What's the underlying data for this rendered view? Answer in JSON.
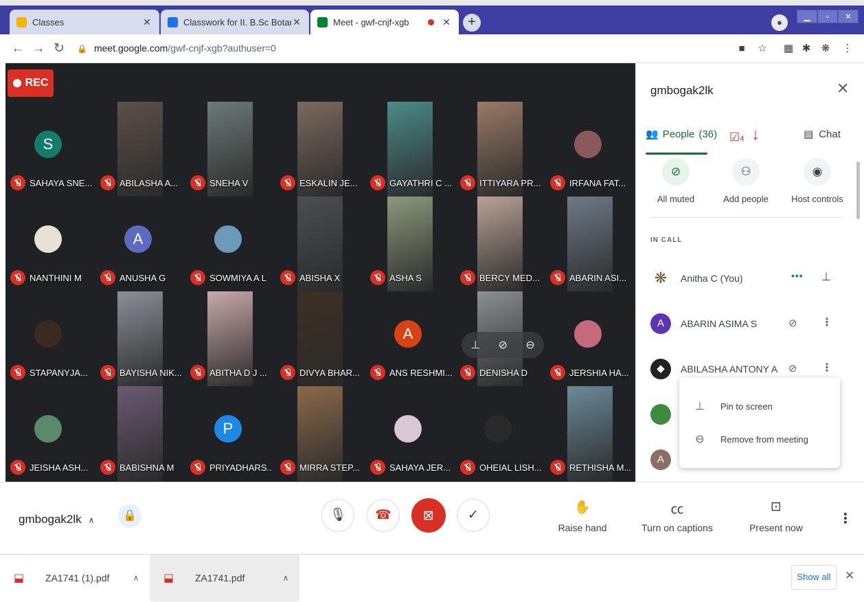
{
  "browser": {
    "tabs": [
      {
        "title": "Classes",
        "favicon_color": "#f4b400"
      },
      {
        "title": "Classwork for II. B.Sc Botany Allie",
        "favicon_color": "#1a73e8"
      },
      {
        "title": "Meet - gwf-cnjf-xgb",
        "favicon_color": "#00832d"
      }
    ],
    "url_host": "meet.google.com",
    "url_path": "/gwf-cnjf-xgb?authuser=0"
  },
  "stage": {
    "rec_label": "REC",
    "tiles": [
      {
        "name": "SAHAYA SNE...",
        "avatar": "S",
        "color": "#137c6b"
      },
      {
        "name": "ABILASHA A...",
        "photo": "#5b5147"
      },
      {
        "name": "SNEHA V",
        "photo": "#6b7b77"
      },
      {
        "name": "ESKALIN JE...",
        "photo": "#7a6a5e"
      },
      {
        "name": "GAYATHRI C ...",
        "photo": "#4a8b88"
      },
      {
        "name": "ITTIYARA PR...",
        "photo": "#9a7a66"
      },
      {
        "name": "IRFANA FAT...",
        "small_avatar": "#8a5a5a"
      },
      {
        "name": "NANTHINI M",
        "small_avatar": "#e8e2d5"
      },
      {
        "name": "ANUSHA G",
        "avatar": "A",
        "color": "#5c6bc0"
      },
      {
        "name": "SOWMIYA A L",
        "small_avatar": "#6b9bb8"
      },
      {
        "name": "ABISHA X",
        "photo": "#4b4e52"
      },
      {
        "name": "ASHA S",
        "photo": "#8a9a7a"
      },
      {
        "name": "BERCY MED...",
        "photo": "#b9a296"
      },
      {
        "name": "ABARIN ASI...",
        "photo": "#6d7a86"
      },
      {
        "name": "STAPANYJA...",
        "small_avatar": "#3a2a20"
      },
      {
        "name": "BAYISHA NIK...",
        "photo": "#8b9098"
      },
      {
        "name": "ABITHA D J ...",
        "photo": "#c9a9aa"
      },
      {
        "name": "DIVYA BHAR...",
        "photo": "#3d3024"
      },
      {
        "name": "ANS RESHMI...",
        "avatar": "A",
        "color": "#d84315"
      },
      {
        "name": "DENISHA D",
        "photo": "#8a8f92"
      },
      {
        "name": "JERSHIA HA...",
        "small_avatar": "#c56a7a"
      },
      {
        "name": "JEISHA ASH...",
        "small_avatar": "#5a8a6a"
      },
      {
        "name": "BABISHNA M",
        "photo": "#6a5a72"
      },
      {
        "name": "PRIYADHARS...",
        "avatar": "P",
        "color": "#1e88e5"
      },
      {
        "name": "MIRRA STEP...",
        "photo": "#8a6a4a"
      },
      {
        "name": "SAHAYA JER...",
        "small_avatar": "#d9c6d6"
      },
      {
        "name": "OHEIAL LISH...",
        "small_avatar": "#2a2a2a"
      },
      {
        "name": "RETHISHA M...",
        "photo": "#6a8a98"
      }
    ]
  },
  "panel": {
    "title": "gmbogak2lk",
    "people_tab": "People",
    "people_count": "(36)",
    "chat_tab": "Chat",
    "annotation_count": "4",
    "actions": [
      {
        "label": "All muted",
        "icon": "mic-off-icon"
      },
      {
        "label": "Add people",
        "icon": "add-person-icon"
      },
      {
        "label": "Host controls",
        "icon": "toggle-icon"
      }
    ],
    "section_label": "IN CALL",
    "participants": [
      {
        "name": "Anitha C (You)",
        "color": "#ffffff"
      },
      {
        "name": "ABARIN ASIMA S",
        "color": "#5e35b1",
        "initial": "A"
      },
      {
        "name": "ABILASHA ANTONY A",
        "color": "#222222"
      },
      {
        "name": "",
        "color": "#3e8a3e"
      },
      {
        "name": "",
        "color": "#8d6e63",
        "initial": "A"
      }
    ],
    "menu": [
      "Pin to screen",
      "Remove from meeting"
    ]
  },
  "callbar": {
    "meeting_code": "gmbogak2lk",
    "raise_hand": "Raise hand",
    "captions": "Turn on captions",
    "present": "Present now"
  },
  "downloads": {
    "files": [
      "ZA1741 (1).pdf",
      "ZA1741.pdf"
    ],
    "show_all": "Show all"
  }
}
